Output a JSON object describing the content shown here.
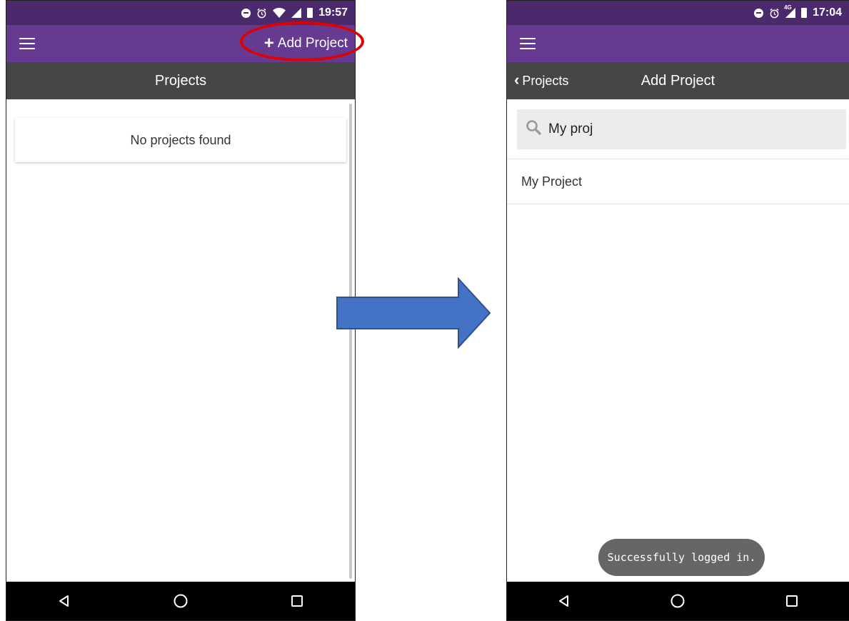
{
  "left_screen": {
    "status_bar": {
      "time": "19:57"
    },
    "app_bar": {
      "add_button_plus": "+",
      "add_button_label": "Add Project"
    },
    "title_bar": {
      "title": "Projects"
    },
    "empty_message": "No projects found"
  },
  "right_screen": {
    "status_bar": {
      "time": "17:04",
      "network_label": "4G"
    },
    "title_bar": {
      "back_label": "Projects",
      "title": "Add Project"
    },
    "search": {
      "value": "My proj"
    },
    "results": [
      {
        "label": "My Project"
      }
    ],
    "toast": "Successfully logged in."
  },
  "colors": {
    "status_bar": "#4a2a6d",
    "app_bar": "#663a90",
    "title_bar": "#464646",
    "highlight": "#e00000",
    "arrow_fill": "#4472c4",
    "arrow_stroke": "#2f528f"
  },
  "icons": {
    "status": [
      "do-not-disturb-icon",
      "alarm-icon",
      "wifi-icon",
      "signal-icon",
      "battery-icon"
    ],
    "app_bar": "hamburger-menu-icon",
    "search": "search-icon",
    "nav": [
      "back-triangle-icon",
      "home-circle-icon",
      "recents-square-icon"
    ]
  }
}
